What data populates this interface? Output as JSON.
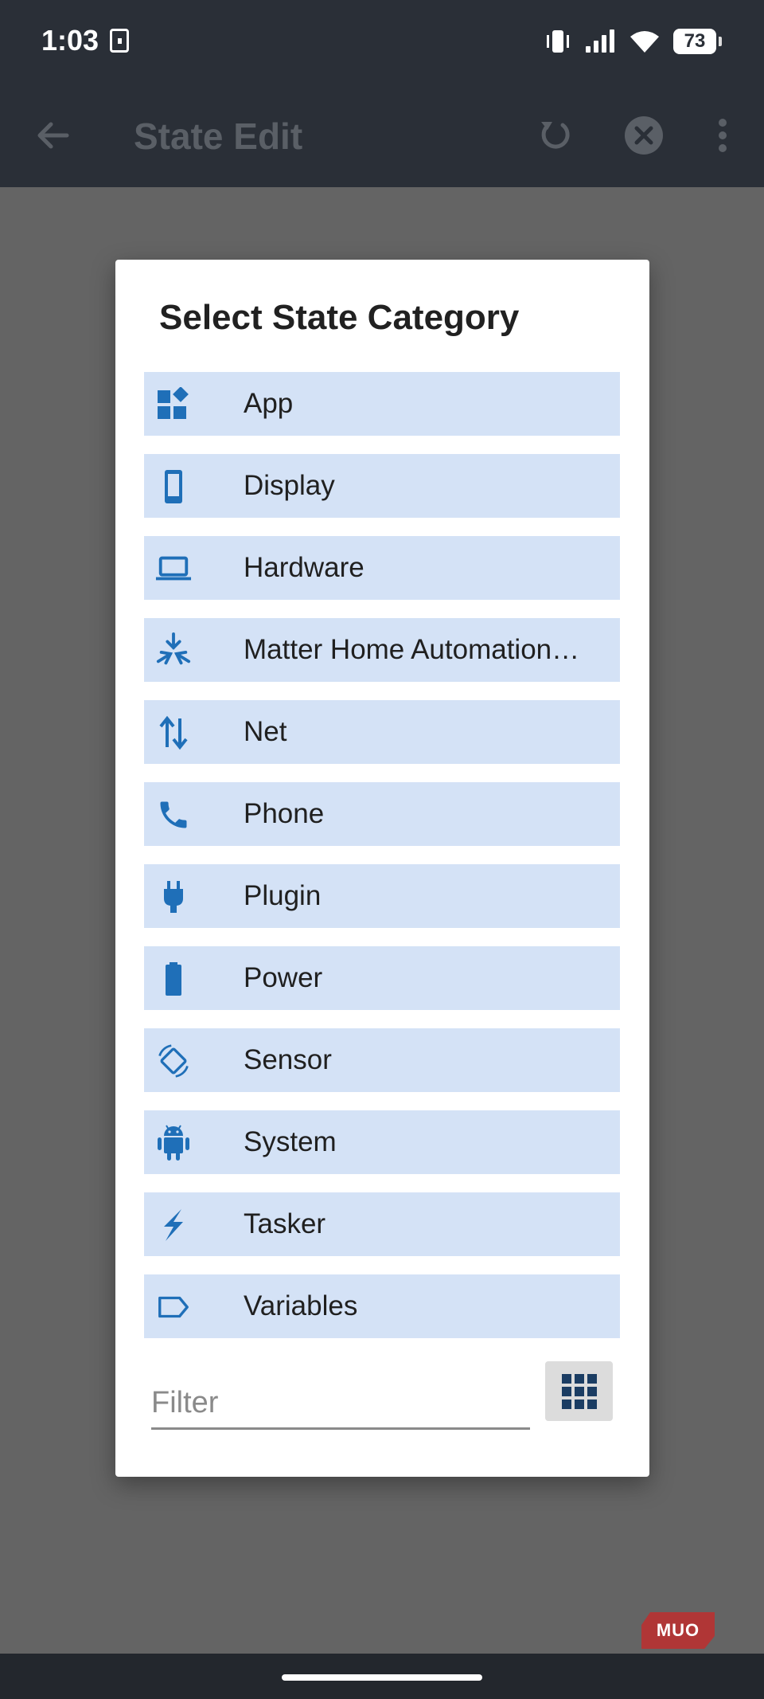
{
  "status_bar": {
    "time": "1:03",
    "battery": "73"
  },
  "app_bar": {
    "title": "State Edit"
  },
  "dialog": {
    "title": "Select State Category",
    "categories": [
      {
        "label": "App",
        "icon": "app-grid-icon"
      },
      {
        "label": "Display",
        "icon": "phone-display-icon"
      },
      {
        "label": "Hardware",
        "icon": "laptop-icon"
      },
      {
        "label": "Matter Home Automation…",
        "icon": "matter-icon"
      },
      {
        "label": "Net",
        "icon": "up-down-arrows-icon"
      },
      {
        "label": "Phone",
        "icon": "phone-handset-icon"
      },
      {
        "label": "Plugin",
        "icon": "plug-icon"
      },
      {
        "label": "Power",
        "icon": "battery-icon"
      },
      {
        "label": "Sensor",
        "icon": "screen-rotation-icon"
      },
      {
        "label": "System",
        "icon": "android-icon"
      },
      {
        "label": "Tasker",
        "icon": "lightning-bolt-icon"
      },
      {
        "label": "Variables",
        "icon": "label-tag-icon"
      }
    ],
    "filter_placeholder": "Filter"
  },
  "watermark": "MUO",
  "colors": {
    "accent": "#1f6fb8",
    "row_bg": "#d4e2f6",
    "app_bar": "#2a2f37",
    "scrim": "#646464"
  }
}
